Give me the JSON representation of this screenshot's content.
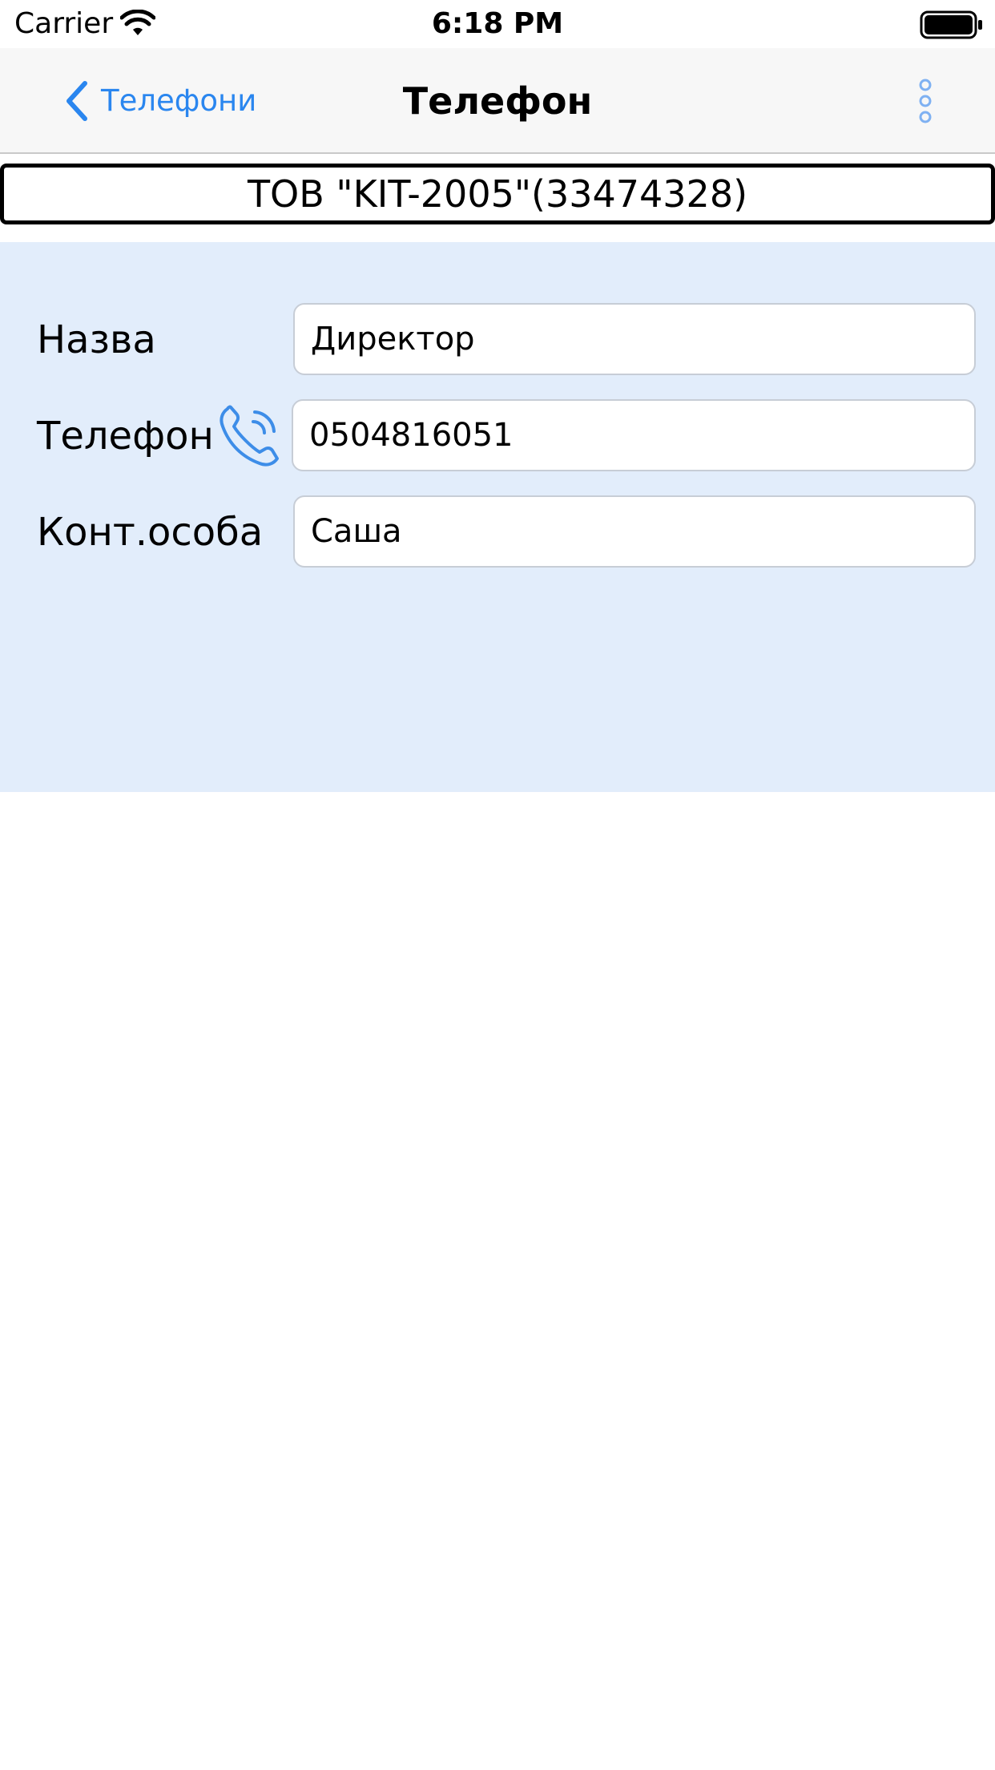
{
  "status_bar": {
    "carrier": "Carrier",
    "time": "6:18 PM"
  },
  "nav": {
    "back_label": "Телефони",
    "title": "Телефон",
    "accent_color": "#2a86ef"
  },
  "company": {
    "name": "ТОВ \"KIT-2005\"(33474328)"
  },
  "form": {
    "background_color": "#e2edfb",
    "name_label": "Назва",
    "name_value": "Директор",
    "phone_label": "Телефон",
    "phone_value": "0504816051",
    "contact_label": "Конт.особа",
    "contact_value": "Саша"
  },
  "icons": {
    "wifi": "wifi-icon",
    "battery": "battery-icon",
    "back": "chevron-left-icon",
    "more": "more-vertical-icon",
    "call": "phone-call-icon"
  }
}
